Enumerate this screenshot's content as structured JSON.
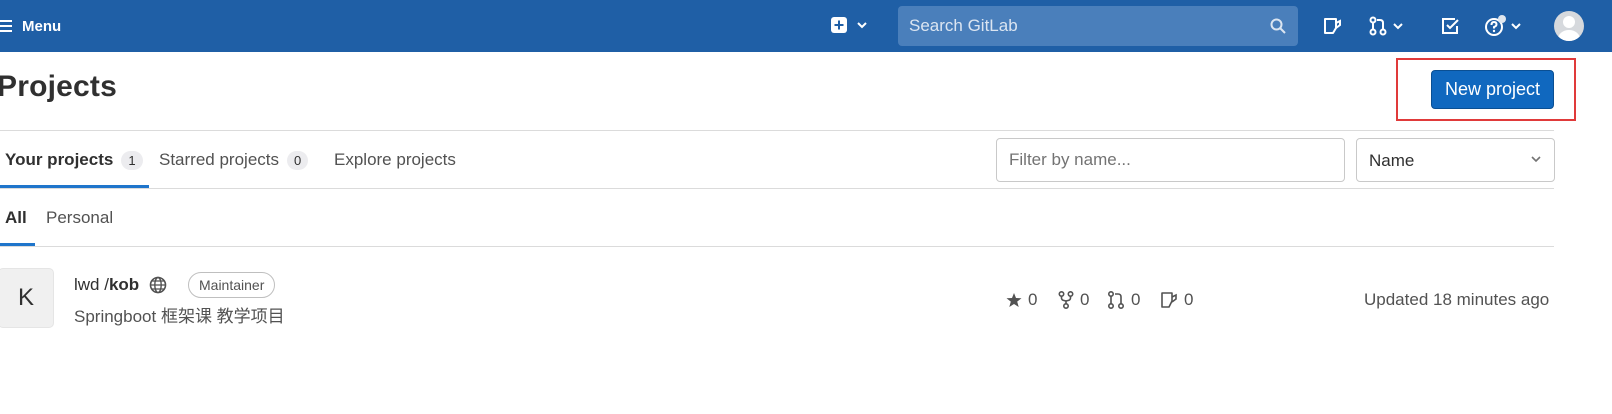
{
  "navbar": {
    "menu_label": "Menu",
    "search_placeholder": "Search GitLab"
  },
  "header": {
    "title": "Projects",
    "new_project_label": "New project"
  },
  "tabs": [
    {
      "label": "Your projects",
      "count": "1"
    },
    {
      "label": "Starred projects",
      "count": "0"
    },
    {
      "label": "Explore projects"
    }
  ],
  "filter": {
    "placeholder": "Filter by name...",
    "sort_value": "Name"
  },
  "subtabs": [
    {
      "label": "All"
    },
    {
      "label": "Personal"
    }
  ],
  "project": {
    "avatar_letter": "K",
    "namespace": "lwd / ",
    "name": "kob",
    "role": "Maintainer",
    "description": "Springboot 框架课 教学项目",
    "stars": "0",
    "forks": "0",
    "merge_requests": "0",
    "issues": "0",
    "updated": "Updated 18 minutes ago"
  },
  "colors": {
    "navbar": "#1f5fa6",
    "primary_button": "#1068bf",
    "highlight": "#e03a3a"
  }
}
